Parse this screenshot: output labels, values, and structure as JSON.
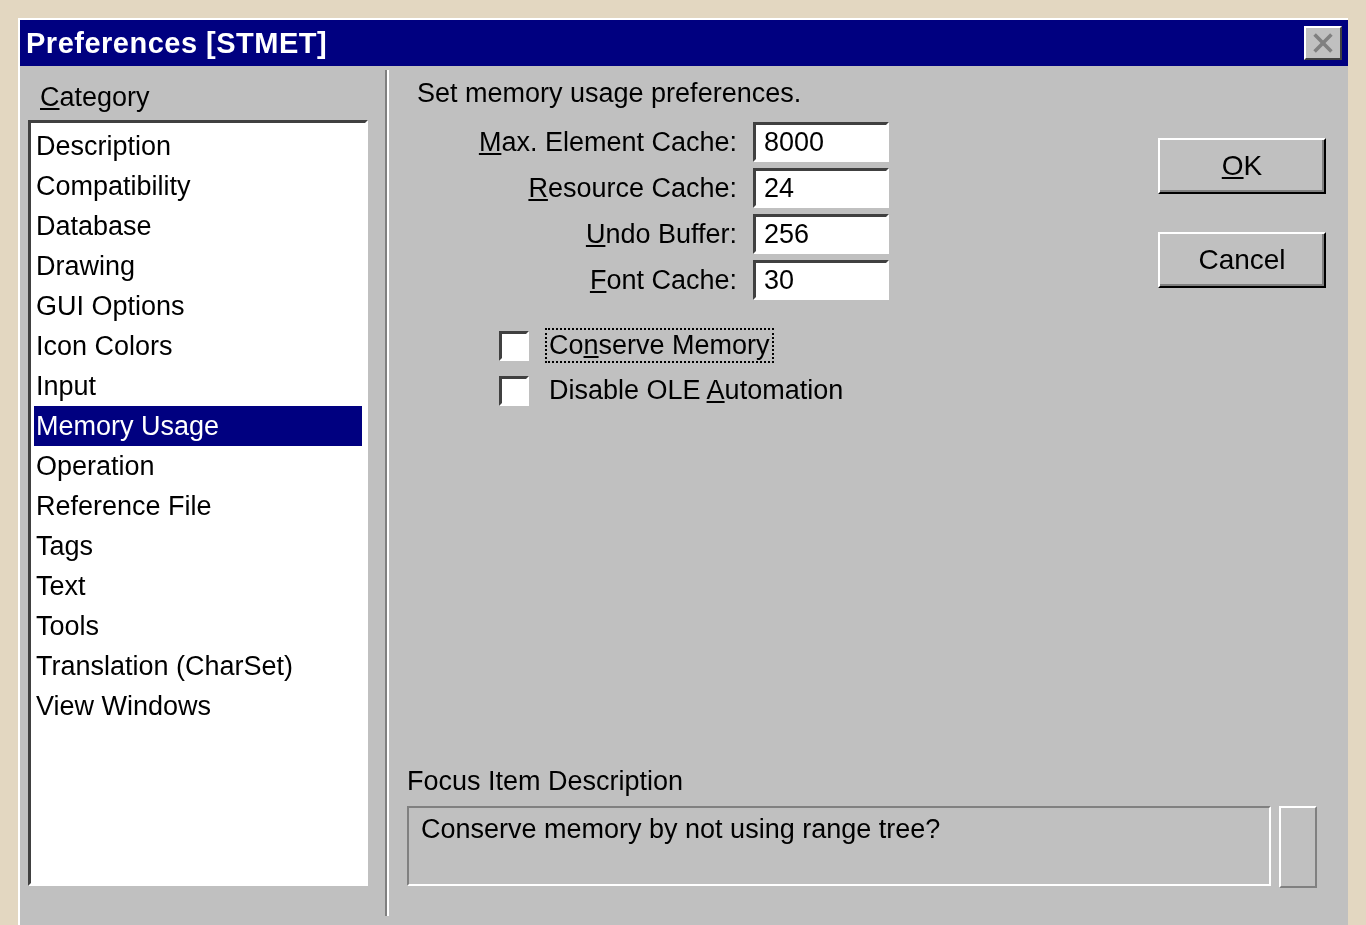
{
  "window": {
    "title": "Preferences [STMET]"
  },
  "category": {
    "label": {
      "key": "C",
      "post": "ategory"
    },
    "items": [
      {
        "label": "Description",
        "selected": false
      },
      {
        "label": "Compatibility",
        "selected": false
      },
      {
        "label": "Database",
        "selected": false
      },
      {
        "label": "Drawing",
        "selected": false
      },
      {
        "label": "GUI Options",
        "selected": false
      },
      {
        "label": "Icon Colors",
        "selected": false
      },
      {
        "label": "Input",
        "selected": false
      },
      {
        "label": "Memory Usage",
        "selected": true
      },
      {
        "label": "Operation",
        "selected": false
      },
      {
        "label": "Reference File",
        "selected": false
      },
      {
        "label": "Tags",
        "selected": false
      },
      {
        "label": "Text",
        "selected": false
      },
      {
        "label": "Tools",
        "selected": false
      },
      {
        "label": "Translation (CharSet)",
        "selected": false
      },
      {
        "label": "View Windows",
        "selected": false
      }
    ]
  },
  "intro": "Set memory usage preferences.",
  "fields": [
    {
      "label": {
        "key": "M",
        "post": "ax. Element Cache:"
      },
      "value": "8000"
    },
    {
      "label": {
        "key": "R",
        "post": "esource Cache:"
      },
      "value": "24"
    },
    {
      "label": {
        "key": "U",
        "post": "ndo Buffer:"
      },
      "value": "256"
    },
    {
      "label": {
        "key": "F",
        "post": "ont Cache:"
      },
      "value": "30"
    }
  ],
  "checkboxes": [
    {
      "label": {
        "pre": "Co",
        "key": "n",
        "post": "serve Memory"
      },
      "checked": false,
      "focused": true
    },
    {
      "label": {
        "pre": "Disable OLE ",
        "key": "A",
        "post": "utomation"
      },
      "checked": false,
      "focused": false
    }
  ],
  "buttons": [
    {
      "label": {
        "key": "O",
        "post": "K"
      }
    },
    {
      "label": {
        "pre": "Cancel"
      }
    }
  ],
  "description": {
    "label": "Focus Item Description",
    "text": "Conserve memory by not using range tree?"
  }
}
